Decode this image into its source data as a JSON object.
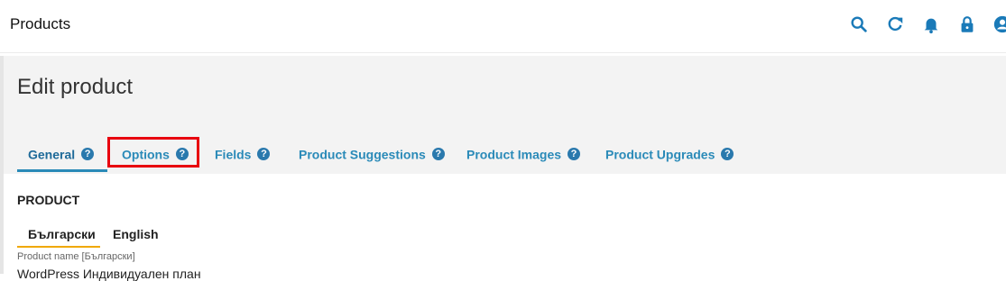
{
  "topbar": {
    "title": "Products",
    "icons": [
      "search-icon",
      "refresh-icon",
      "bell-icon",
      "lock-icon",
      "user-icon"
    ]
  },
  "page": {
    "heading": "Edit product",
    "tabs": [
      {
        "label": "General",
        "help": "?"
      },
      {
        "label": "Options",
        "help": "?"
      },
      {
        "label": "Fields",
        "help": "?"
      },
      {
        "label": "Product Suggestions",
        "help": "?"
      },
      {
        "label": "Product Images",
        "help": "?"
      },
      {
        "label": "Product Upgrades",
        "help": "?"
      }
    ],
    "active_tab": "General",
    "section_title": "PRODUCT",
    "languages": [
      "Български",
      "English"
    ],
    "active_language": "Български",
    "field": {
      "label": "Product name [Български]",
      "value": "WordPress Индивидуален план"
    }
  },
  "colors": {
    "accent": "#2a8ab8",
    "help_icon": "#2a79ad",
    "highlight": "#e8000e",
    "language_underline": "#f0a800"
  }
}
